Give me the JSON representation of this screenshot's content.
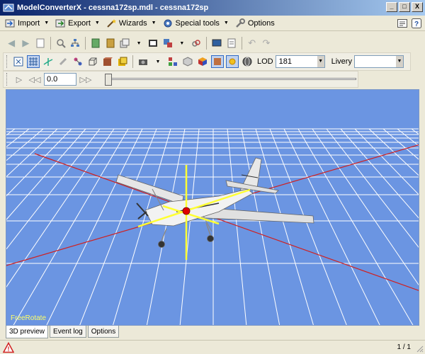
{
  "window": {
    "title": "ModelConverterX - cessna172sp.mdl - cessna172sp",
    "minimize": "_",
    "maximize": "□",
    "close": "X"
  },
  "menu": {
    "import": "Import",
    "export": "Export",
    "wizards": "Wizards",
    "special_tools": "Special tools",
    "options": "Options"
  },
  "toolbar": {
    "lod_label": "LOD",
    "lod_value": "181",
    "livery_label": "Livery",
    "livery_value": ""
  },
  "animation": {
    "time_value": "0.0",
    "slider_position": 0
  },
  "viewport": {
    "mode_label": "FreeRotate",
    "background_color": "#6b95e2"
  },
  "tabs": [
    {
      "label": "3D preview",
      "active": true
    },
    {
      "label": "Event log",
      "active": false
    },
    {
      "label": "Options",
      "active": false
    }
  ],
  "status": {
    "page_count": "1 / 1"
  },
  "colors": {
    "grid": "#ffffff",
    "axis_red": "#d02020",
    "gizmo": "#ffff33",
    "pivot": "#e00000"
  }
}
